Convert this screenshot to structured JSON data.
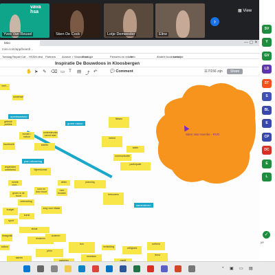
{
  "call": {
    "tiles": [
      {
        "name": "Yves Van Reusel",
        "logo": "vava hsa"
      },
      {
        "name": "Stien De Cock"
      },
      {
        "name": "Lotje Demeester"
      },
      {
        "name": "Eline"
      }
    ],
    "view_label": "View",
    "next_icon": "chevron-right-icon"
  },
  "participants": {
    "badges": [
      {
        "initials": "SV",
        "color": "#1e8e3e"
      },
      {
        "initials": "Y",
        "color": "#1e8e3e"
      },
      {
        "initials": "GV",
        "color": "#1e8e3e"
      },
      {
        "initials": "LD",
        "color": "#5e35b1"
      },
      {
        "initials": "ST",
        "color": "#f4511e"
      },
      {
        "initials": "S",
        "color": "#3f51b5"
      },
      {
        "initials": "BL",
        "color": "#3949ab"
      },
      {
        "initials": "E",
        "color": "#3949ab"
      },
      {
        "initials": "CP",
        "color": "#3949ab"
      },
      {
        "initials": "DC",
        "color": "#d93025"
      },
      {
        "initials": "E",
        "color": "#1e8e3e"
      },
      {
        "initials": "L",
        "color": "#1e8e3e"
      }
    ],
    "check_text": "✓",
    "footer_text": "ye"
  },
  "browser": {
    "tab_title": "Miro",
    "address": "miro.com/app/board/...",
    "bookmarks": [
      "Toelaag Repair Caf...",
      "HSSM.nest",
      "Partners",
      "Avance > Vlaanderen",
      "Ecologie",
      "Pensees en relatie",
      "Info",
      "Andere bookmarks",
      "Leeslijst"
    ]
  },
  "app": {
    "board_title": "Inspiratie De Bouwdoos in Kloosbergen",
    "zoom": "117/156 zijn",
    "share_label": "Share",
    "comment_label": "Comment",
    "avatars": [
      {
        "label": "ST",
        "color": "#f4511e"
      },
      {
        "label": "DE",
        "color": "#d93025"
      },
      {
        "label": "SV",
        "color": "#1e8e3e"
      },
      {
        "label": "LD",
        "color": "#5e35b1"
      },
      {
        "label": "SV",
        "color": "#7b2fbe"
      }
    ]
  },
  "canvas": {
    "cursor_name": "Stien Van Hoecke - RVO",
    "cloud_color": "#f7941d",
    "tags": [
      {
        "text": "openbaarheid"
      },
      {
        "text": "groen natuur"
      },
      {
        "text": "plan uitvoering"
      },
      {
        "text": "samenleven"
      }
    ],
    "notes": [
      {
        "text": "veel..."
      },
      {
        "text": "samenwerk"
      },
      {
        "text": "gebruik publiek"
      },
      {
        "text": "bomen / natuur"
      },
      {
        "text": "ondersteuning vanuit stad"
      },
      {
        "text": "buurtwerk"
      },
      {
        "text": "ideeën"
      },
      {
        "text": "respecteer onbekend"
      },
      {
        "text": "bijeenkomst"
      },
      {
        "text": "ruimte voor..."
      },
      {
        "text": "voor en door buurt"
      },
      {
        "text": "groen in de buurt"
      },
      {
        "text": "ontmoeting"
      },
      {
        "text": "budget"
      },
      {
        "text": "zorg voor elkaar"
      },
      {
        "text": "delen"
      },
      {
        "text": "mee bouwen"
      },
      {
        "text": "planning"
      },
      {
        "text": "bewoners"
      },
      {
        "text": "beleid"
      },
      {
        "text": "communicatie"
      },
      {
        "text": "participatie"
      },
      {
        "text": "draagvlak"
      },
      {
        "text": "straat"
      },
      {
        "text": "kinderen"
      },
      {
        "text": "ouderen"
      },
      {
        "text": "samen"
      },
      {
        "text": "plein"
      },
      {
        "text": "tuin"
      },
      {
        "text": "moestuin"
      },
      {
        "text": "speelruimte"
      },
      {
        "text": "verlichting"
      },
      {
        "text": "veiligheid"
      },
      {
        "text": "netheid"
      },
      {
        "text": "feest"
      },
      {
        "text": "markt"
      },
      {
        "text": "cultuur"
      },
      {
        "text": "kunst"
      },
      {
        "text": "sport"
      },
      {
        "text": "fietsen"
      },
      {
        "text": "parkeren"
      },
      {
        "text": "afval"
      },
      {
        "text": "water"
      },
      {
        "text": "zon"
      },
      {
        "text": "energie"
      }
    ]
  },
  "taskbar": {
    "time": "...",
    "icons": [
      {
        "name": "windows-icon",
        "color": "#0078d4"
      },
      {
        "name": "search-icon",
        "color": "#666"
      },
      {
        "name": "task-view-icon",
        "color": "#888"
      },
      {
        "name": "explorer-icon",
        "color": "#f2c94c"
      },
      {
        "name": "edge-icon",
        "color": "#0a84c6"
      },
      {
        "name": "chrome-icon",
        "color": "#db4437"
      },
      {
        "name": "outlook-icon",
        "color": "#0072c6"
      },
      {
        "name": "word-icon",
        "color": "#2b579a"
      },
      {
        "name": "excel-icon",
        "color": "#217346"
      },
      {
        "name": "acrobat-icon",
        "color": "#d93025"
      },
      {
        "name": "teams-icon",
        "color": "#5b5fc7"
      },
      {
        "name": "ppt-icon",
        "color": "#d24726"
      },
      {
        "name": "misc-icon",
        "color": "#777"
      }
    ]
  }
}
